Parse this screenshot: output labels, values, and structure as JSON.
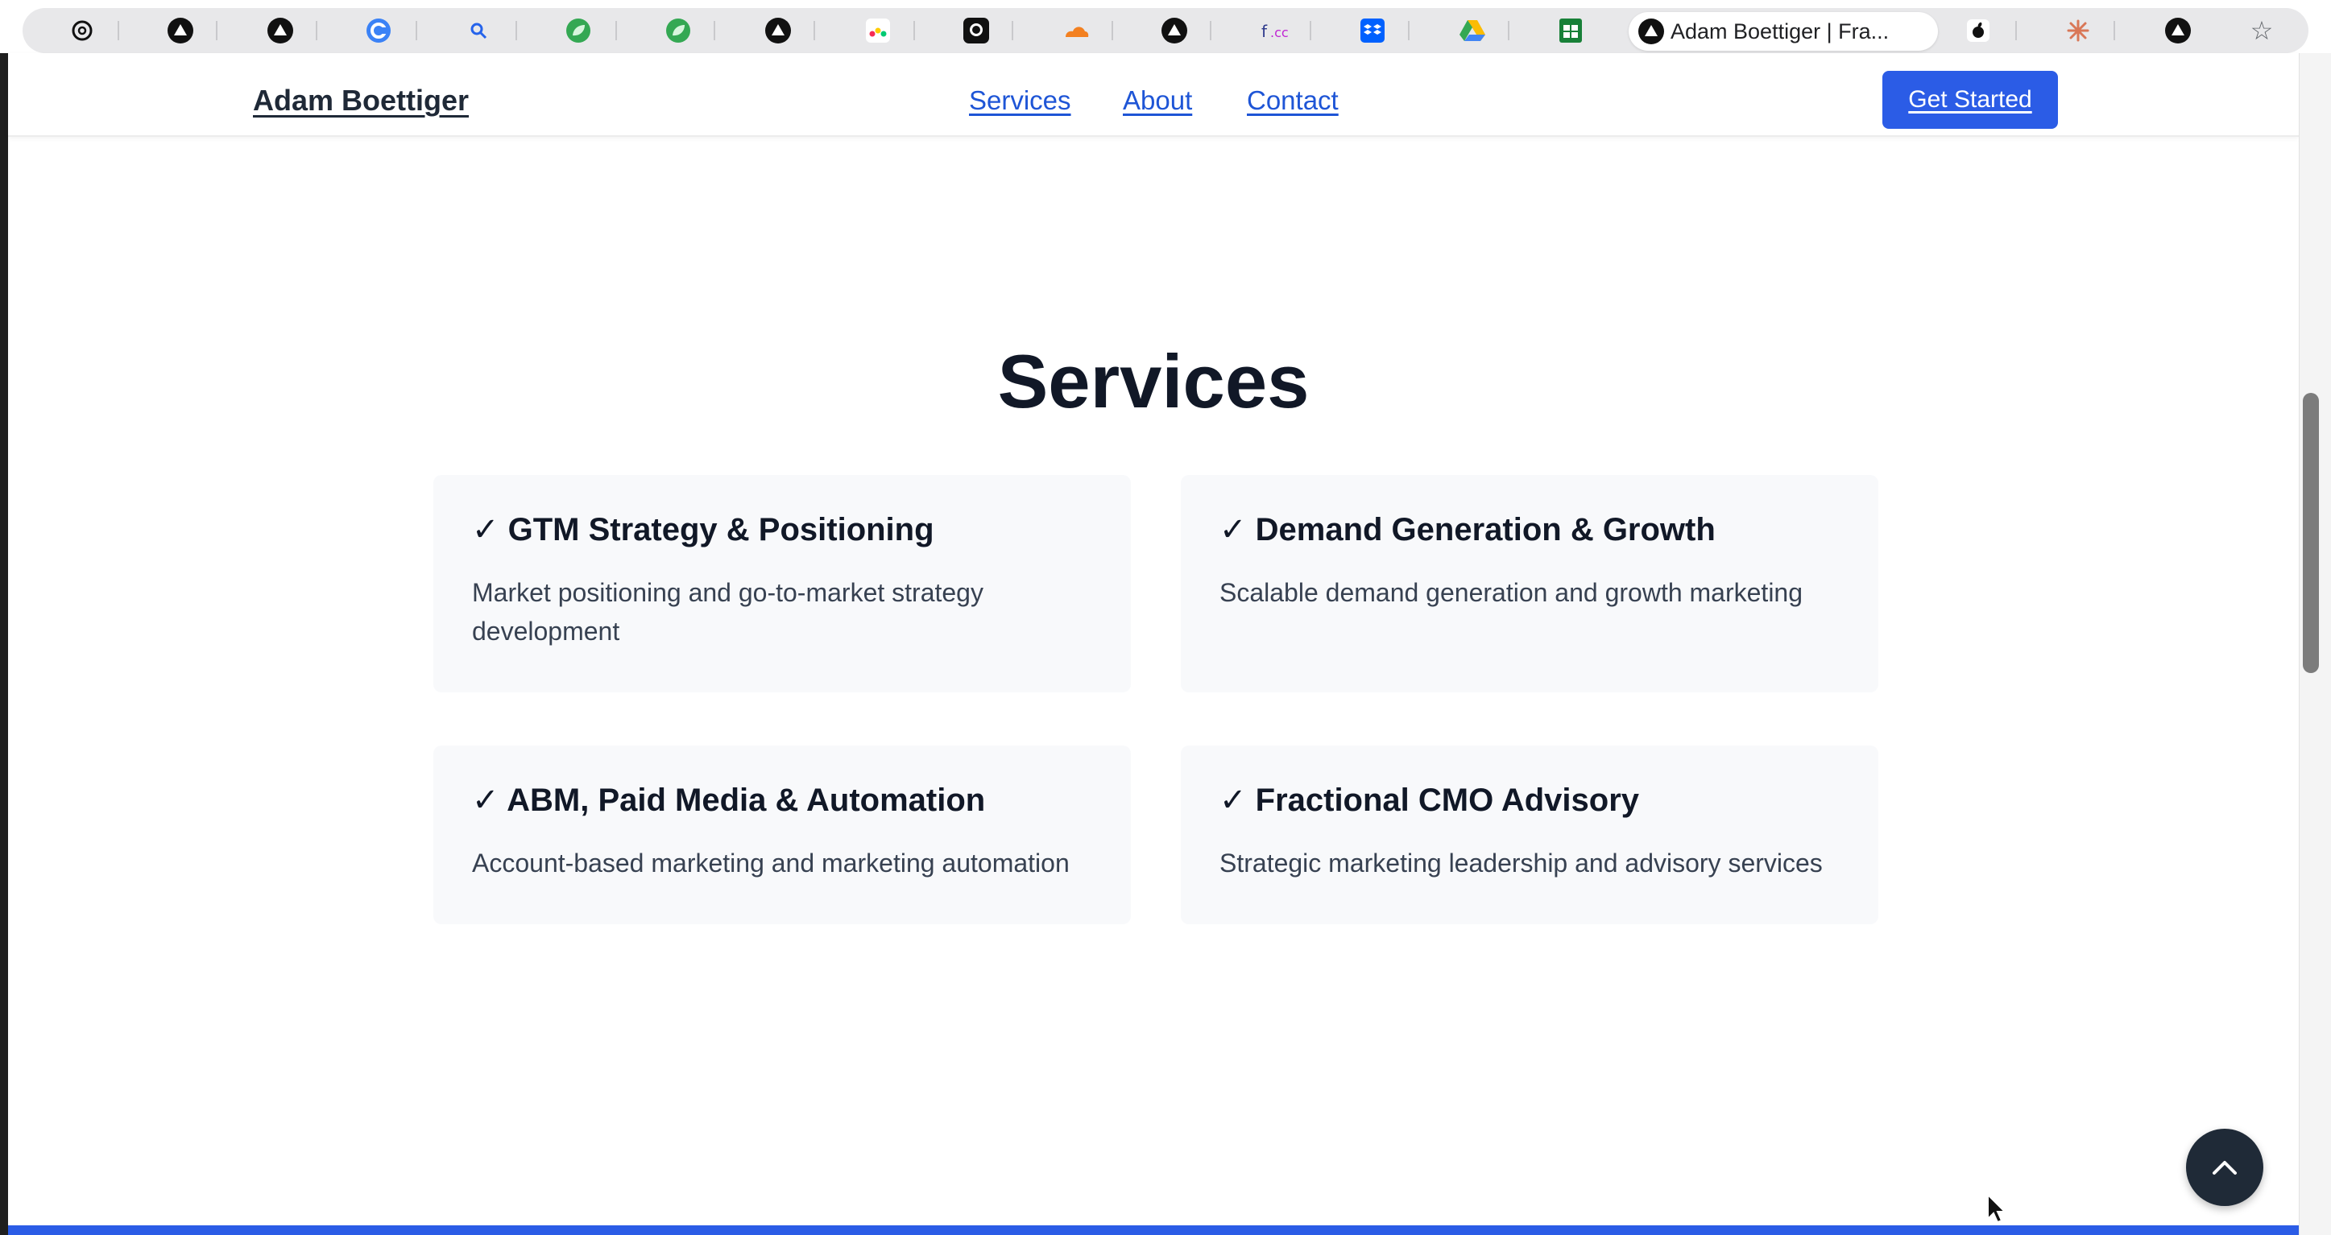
{
  "browser": {
    "tab_icons": [
      "openai-icon",
      "vercel-icon",
      "vercel-icon",
      "circle-c-icon",
      "search-icon",
      "leaf-icon",
      "leaf-icon",
      "vercel-icon",
      "monday-icon",
      "github-icon",
      "cloudflare-icon",
      "vercel-icon",
      "fcc-icon",
      "dropbox-icon",
      "google-drive-icon",
      "google-sheets-icon"
    ],
    "active_tab_title": "Adam Boettiger | Fra...",
    "trailing_icons": [
      "apple-icon",
      "claude-icon",
      "vercel-icon"
    ]
  },
  "header": {
    "brand": "Adam Boettiger",
    "nav": [
      "Services",
      "About",
      "Contact"
    ],
    "cta": "Get Started"
  },
  "services": {
    "title": "Services",
    "items": [
      {
        "title": "✓ GTM Strategy & Positioning",
        "description": "Market positioning and go-to-market strategy development"
      },
      {
        "title": "✓ Demand Generation & Growth",
        "description": "Scalable demand generation and growth marketing"
      },
      {
        "title": "✓ ABM, Paid Media & Automation",
        "description": "Account-based marketing and marketing automation"
      },
      {
        "title": "✓ Fractional CMO Advisory",
        "description": "Strategic marketing leadership and advisory services"
      }
    ]
  },
  "colors": {
    "accent": "#2b5ce6",
    "link": "#1e55d6",
    "heading": "#111827",
    "card_bg": "#f8f9fb",
    "back_to_top": "#1f2a37"
  }
}
